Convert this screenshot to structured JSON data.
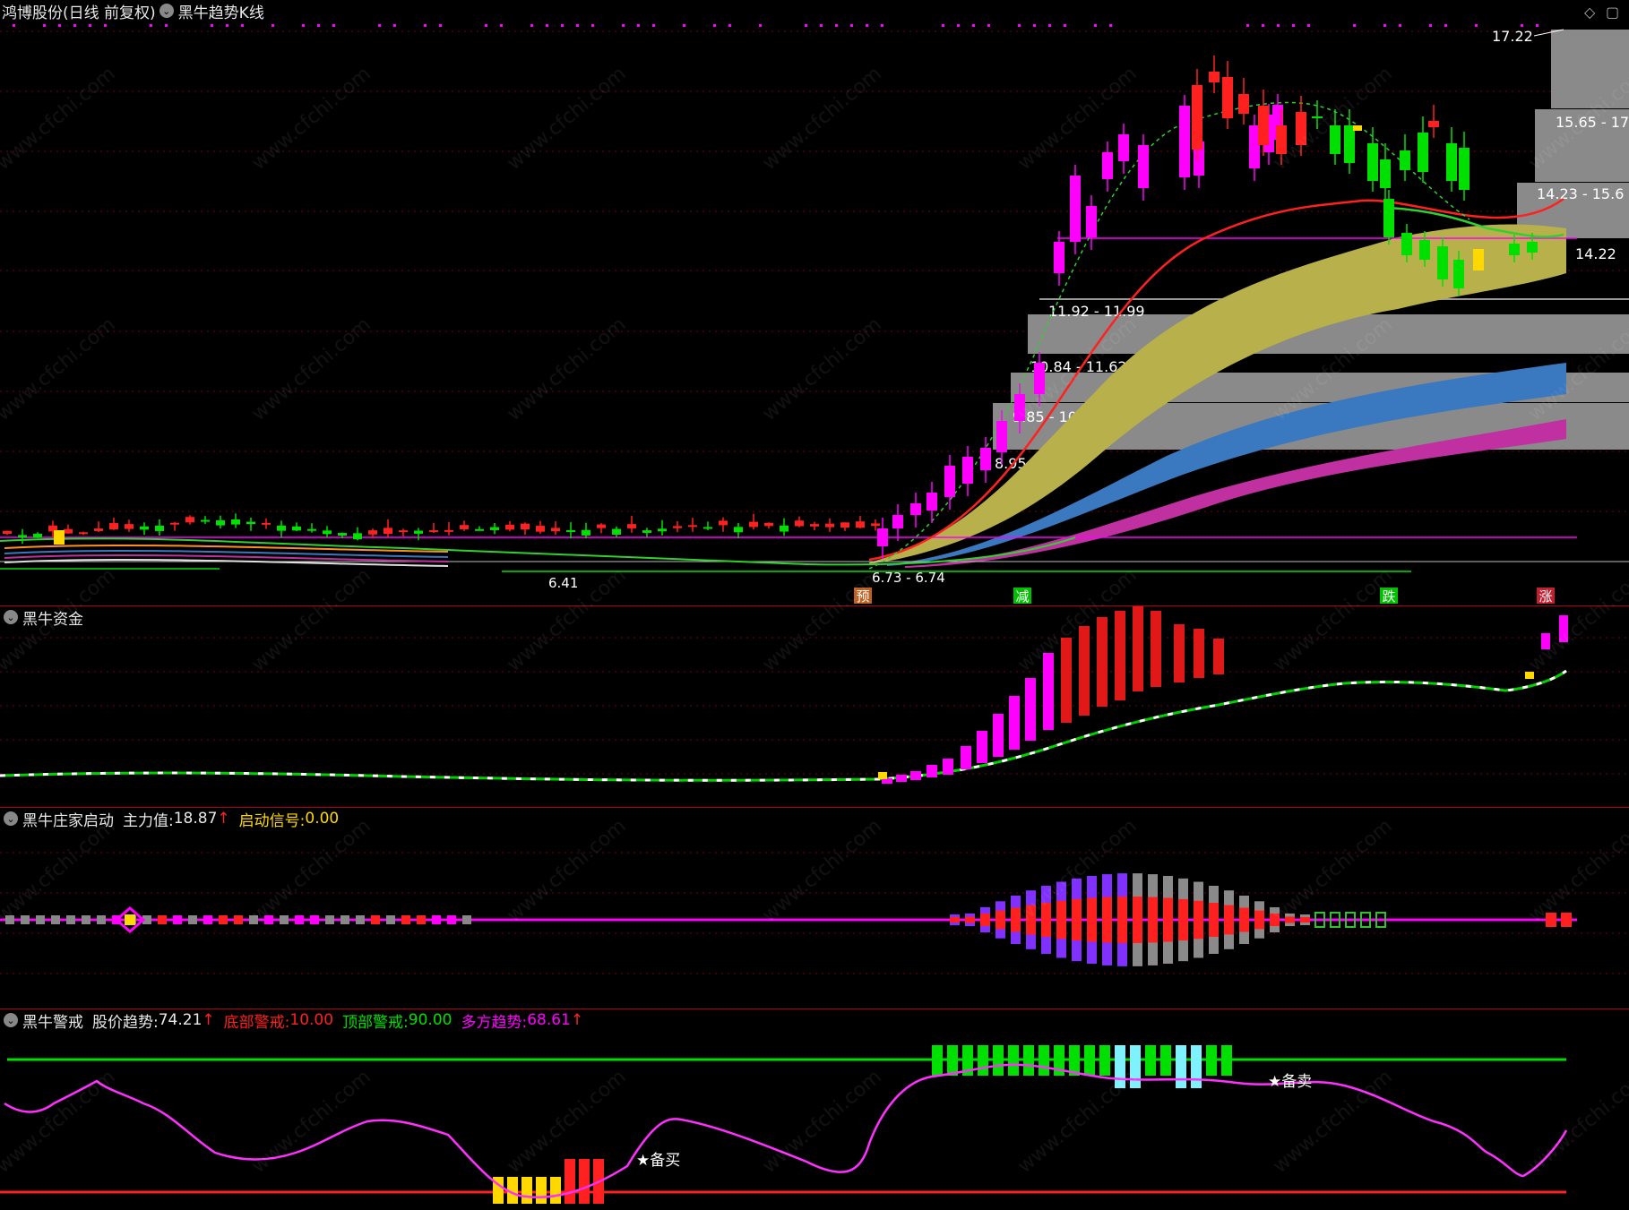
{
  "main": {
    "stock": "鸿博股份(日线 前复权)",
    "indicator": "黑牛趋势K线",
    "top_price": "17.22",
    "level_1422": "14.22",
    "low_label": "6.41",
    "base_zone": "6.73 - 6.74",
    "zones": [
      "15.65 - 17",
      "14.23 - 15.6",
      "11.92 - 11.99",
      "10.84 - 11.62",
      "9.85 - 10.50",
      "8.95 - 9.85"
    ],
    "signals": [
      "预",
      "减",
      "跌",
      "涨"
    ]
  },
  "funds": {
    "title": "黑牛资金"
  },
  "launch": {
    "title": "黑牛庄家启动",
    "main_label": "主力值:",
    "main_value": "18.87",
    "signal_label": "启动信号:",
    "signal_value": "0.00"
  },
  "alert": {
    "title": "黑牛警戒",
    "trend_label": "股价趋势:",
    "trend_value": "74.21",
    "bottom_label": "底部警戒:",
    "bottom_value": "10.00",
    "top_label": "顶部警戒:",
    "top_value": "90.00",
    "bull_label": "多方趋势:",
    "bull_value": "68.61",
    "buy_label": "★备买",
    "sell_label": "★备卖"
  },
  "watermark": "www.cfchi.com",
  "colors": {
    "up": "#ff2020",
    "down": "#00e000",
    "magenta": "#ff00ff",
    "yellow": "#ffd800",
    "band_yellow": "#b8b04a",
    "band_blue": "#3a78c0",
    "band_pink": "#c030a0",
    "zone_gray": "#8a8a8a"
  }
}
